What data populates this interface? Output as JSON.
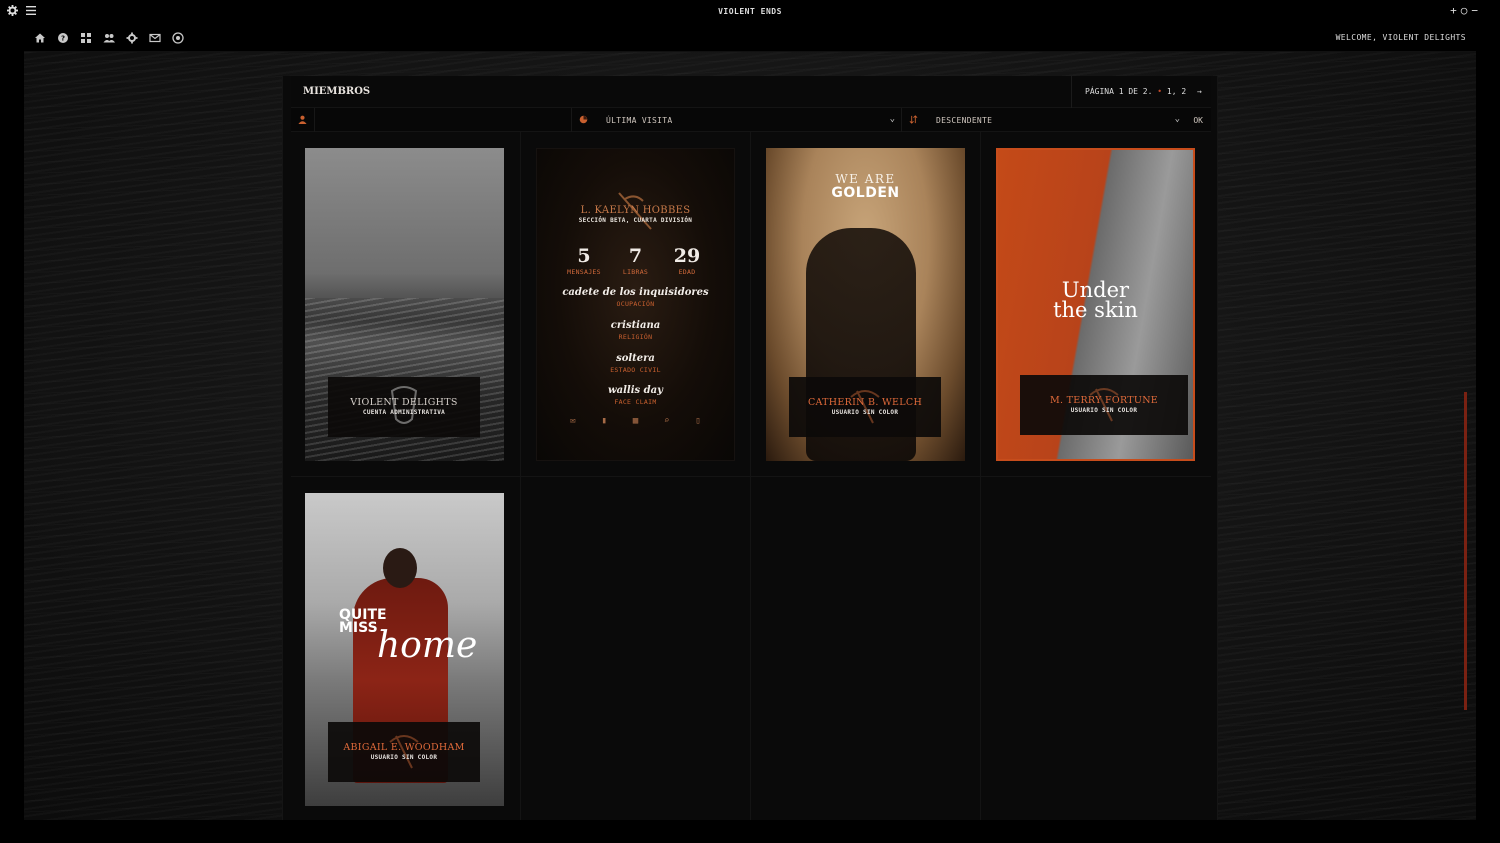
{
  "topbar": {
    "title": "VIOLENT ENDS",
    "controls": [
      "+",
      "○",
      "−"
    ]
  },
  "navbar": {
    "icons": [
      "home-icon",
      "help-icon",
      "groups-icon",
      "members-icon",
      "settings-icon",
      "mail-icon",
      "at-icon"
    ],
    "welcome": "WELCOME, VIOLENT DELIGHTS"
  },
  "panel": {
    "title": "MIEMBROS",
    "pager": {
      "label": "PÁGINA 1 DE 2.",
      "dot": "•",
      "pages": "1, 2"
    }
  },
  "filters": {
    "sort_by": "ÚLTIMA VISITA",
    "order": "DESCENDENTE",
    "ok": "OK"
  },
  "members": [
    {
      "name": "VIOLENT DELIGHTS",
      "role": "CUENTA ADMINISTRATIVA"
    },
    {
      "name": "L. KAELYN HOBBES",
      "role": "SECCIÓN BETA, CUARTA DIVISIÓN",
      "stats": [
        {
          "value": "5",
          "label": "MENSAJES"
        },
        {
          "value": "7",
          "label": "LIBRAS"
        },
        {
          "value": "29",
          "label": "EDAD"
        }
      ],
      "fields": [
        {
          "value": "cadete de los inquisidores",
          "label": "OCUPACIÓN"
        },
        {
          "value": "cristiana",
          "label": "RELIGIÓN"
        },
        {
          "value": "soltera",
          "label": "ESTADO CIVIL"
        },
        {
          "value": "wallis day",
          "label": "FACE CLAIM"
        }
      ]
    },
    {
      "name": "CATHERIN B. WELCH",
      "role": "USUARIO SIN COLOR",
      "art_line1": "WE ARE",
      "art_line2": "GOLDEN"
    },
    {
      "name": "M. TERRY FORTUNE",
      "role": "USUARIO SIN COLOR",
      "art_line1": "Under",
      "art_line2": "the skin"
    },
    {
      "name": "ABIGAIL E. WOODHAM",
      "role": "USUARIO SIN COLOR",
      "art_line1": "QUITE",
      "art_line2": "MISS",
      "art_line3": "home"
    }
  ],
  "colors": {
    "accent": "#c9602f",
    "background": "#000000"
  }
}
